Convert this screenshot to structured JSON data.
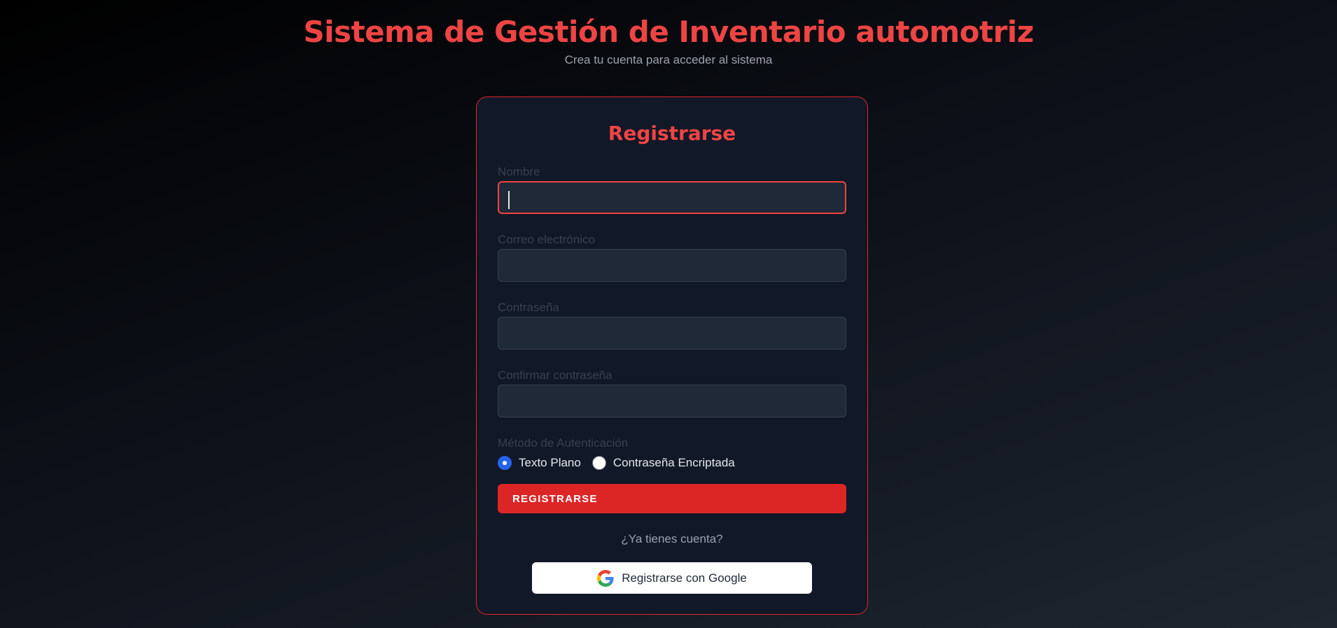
{
  "header": {
    "title": "Sistema de Gestión de Inventario automotriz",
    "subtitle": "Crea tu cuenta para acceder al sistema"
  },
  "form": {
    "title": "Registrarse",
    "fields": [
      {
        "label": "Nombre",
        "value": "",
        "focused": true
      },
      {
        "label": "Correo electrónico",
        "value": ""
      },
      {
        "label": "Contraseña",
        "value": ""
      },
      {
        "label": "Confirmar contraseña",
        "value": ""
      }
    ],
    "auth_method": {
      "label": "Método de Autenticación",
      "options": [
        {
          "label": "Texto Plano",
          "selected": true
        },
        {
          "label": "Contraseña Encriptada",
          "selected": false
        }
      ]
    },
    "submit_label": "REGISTRARSE",
    "login_prompt": "¿Ya tienes cuenta?",
    "google_label": "Registrarse con Google"
  },
  "colors": {
    "accent": "#ef4444",
    "button": "#dc2626",
    "radio_selected": "#2563eb",
    "card_background": "#111827",
    "input_background": "#1f2937"
  },
  "icons": {
    "google": "google-g-icon"
  }
}
